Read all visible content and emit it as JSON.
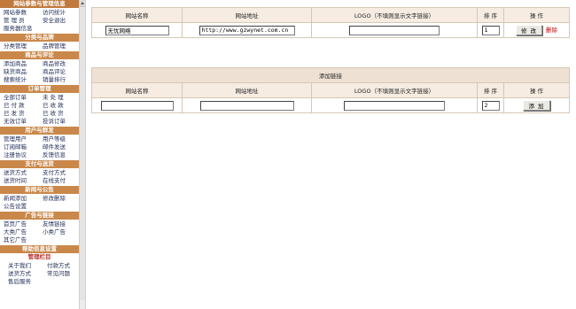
{
  "sidebar": {
    "sections": [
      {
        "title": "网站参数与管理信息",
        "style": "first",
        "rows": [
          [
            "网站参数",
            "访问统计"
          ],
          [
            "管 理 员",
            "安全退出"
          ],
          [
            "服务器信息",
            ""
          ]
        ]
      },
      {
        "title": "分类与品牌",
        "style": "",
        "rows": [
          [
            "分类管理",
            "品牌管理"
          ]
        ]
      },
      {
        "title": "商品与评论",
        "style": "",
        "rows": [
          [
            "添加商品",
            "商品修改"
          ],
          [
            "缺货商品",
            "商品评论"
          ],
          [
            "搜索统计",
            "销量排行"
          ]
        ]
      },
      {
        "title": "订单管理",
        "style": "",
        "rows": [
          [
            "全部订单",
            "未 处 理"
          ],
          [
            "已 付 款",
            "已 收 款"
          ],
          [
            "已 发 货",
            "已 收 货"
          ],
          [
            "无效订单",
            "投诉订单"
          ]
        ]
      },
      {
        "title": "用户与群发",
        "style": "",
        "rows": [
          [
            "管理用户",
            "用户等级"
          ],
          [
            "订阅邮箱",
            "邮件发送"
          ],
          [
            "注册协议",
            "反馈信息"
          ]
        ]
      },
      {
        "title": "支付与送货",
        "style": "",
        "rows": [
          [
            "送货方式",
            "支付方式"
          ],
          [
            "送货时间",
            "在线支付"
          ]
        ]
      },
      {
        "title": "新闻与公告",
        "style": "",
        "rows": [
          [
            "新闻添加",
            "修改删除"
          ],
          [
            "公告设置",
            ""
          ]
        ]
      },
      {
        "title": "广告与链接",
        "style": "",
        "rows": [
          [
            "首页广告",
            "友情链接"
          ],
          [
            "大类广告",
            "小类广告"
          ],
          [
            "其它广告",
            ""
          ]
        ]
      },
      {
        "title": "帮助信息设置",
        "style": "",
        "rows": []
      },
      {
        "title": "管理栏目",
        "style": "plain",
        "rows": [
          [
            "关于我们",
            "付款方式"
          ],
          [
            "送货方式",
            "常见问题"
          ],
          [
            "售后服务",
            ""
          ]
        ]
      }
    ]
  },
  "links_table": {
    "headers": [
      "网站名称",
      "网站地址",
      "LOGO（不填则显示文字链接）",
      "排 序",
      "操 作"
    ],
    "rows": [
      {
        "name": "无忧网络",
        "url": "http://www.gzwynet.com.cn",
        "logo": "",
        "order": "1",
        "edit_label": "修 改",
        "delete_label": "删除"
      }
    ]
  },
  "add_table": {
    "caption": "添加链接",
    "headers": [
      "网站名称",
      "网站地址",
      "LOGO（不填则显示文字链接）",
      "排 序",
      "操 作"
    ],
    "name_value": "",
    "url_value": "",
    "logo_value": "",
    "order_value": "2",
    "add_label": "添 加"
  },
  "colors": {
    "section_header": "#c9884a",
    "table_header": "#f6ece2",
    "table_border": "#d7c7b4",
    "delete_link": "#c00000"
  }
}
